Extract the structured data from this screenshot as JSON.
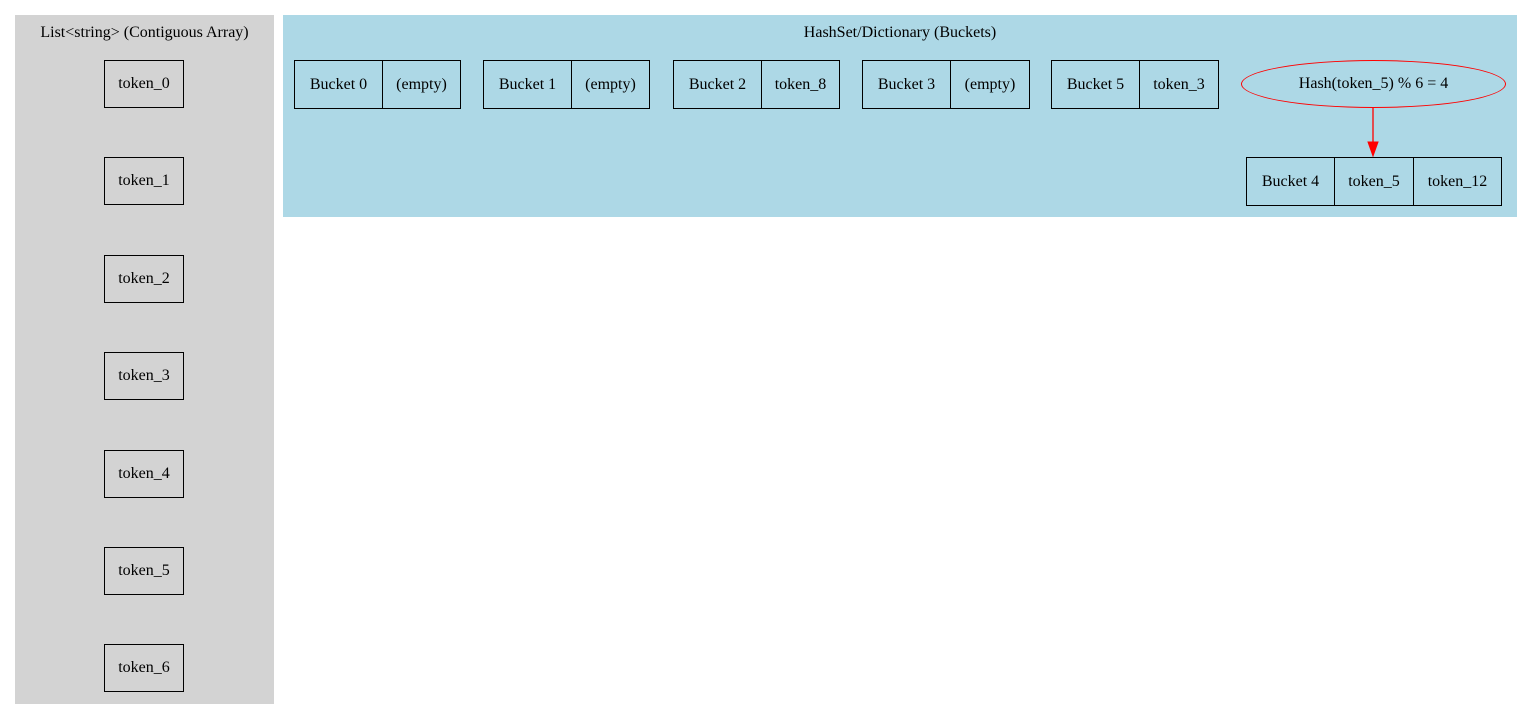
{
  "list_cluster": {
    "title": "List<string> (Contiguous Array)",
    "tokens": [
      "token_0",
      "token_1",
      "token_2",
      "token_3",
      "token_4",
      "token_5",
      "token_6"
    ]
  },
  "hash_cluster": {
    "title": "HashSet/Dictionary (Buckets)",
    "buckets": [
      {
        "label": "Bucket 0",
        "entries": [
          "(empty)"
        ]
      },
      {
        "label": "Bucket 1",
        "entries": [
          "(empty)"
        ]
      },
      {
        "label": "Bucket 2",
        "entries": [
          "token_8"
        ]
      },
      {
        "label": "Bucket 3",
        "entries": [
          "(empty)"
        ]
      },
      {
        "label": "Bucket 5",
        "entries": [
          "token_3"
        ]
      },
      {
        "label": "Bucket 4",
        "entries": [
          "token_5",
          "token_12"
        ]
      }
    ],
    "hash_expression": "Hash(token_5) % 6 = 4"
  },
  "colors": {
    "list_background": "#d3d3d3",
    "hash_background": "#add8e6",
    "highlight": "#ff0000"
  }
}
